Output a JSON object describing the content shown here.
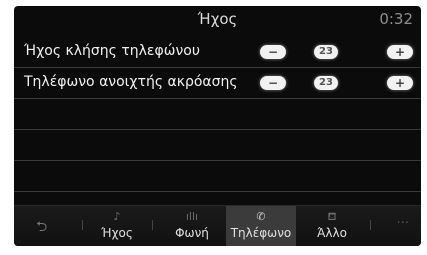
{
  "header": {
    "title": "Ήχος",
    "clock": "0:32"
  },
  "settings": [
    {
      "label": "Ήχος κλήσης τηλεφώνου",
      "minus": "−",
      "value": "23",
      "plus": "+"
    },
    {
      "label": "Τηλέφωνο ανοιχτής ακρόασης",
      "minus": "−",
      "value": "23",
      "plus": "+"
    }
  ],
  "tabbar": {
    "back_icon": "back-arrow-icon",
    "tabs": [
      {
        "label": "Ήχος",
        "icon": "music-note-icon",
        "icon_glyph": "♪"
      },
      {
        "label": "Φωνή",
        "icon": "voice-icon",
        "icon_glyph": "ıllı"
      },
      {
        "label": "Τηλέφωνο",
        "icon": "phone-icon",
        "icon_glyph": "✆"
      },
      {
        "label": "Άλλο",
        "icon": "car-seat-icon",
        "icon_glyph": "⛾"
      }
    ],
    "active_tab": "Τηλέφωνο",
    "more_glyph": "···"
  },
  "colors": {
    "screen_bg": "#0b0b0b",
    "active_tab_bg": "#3b3b3b",
    "pill": "#f2f2f2"
  }
}
